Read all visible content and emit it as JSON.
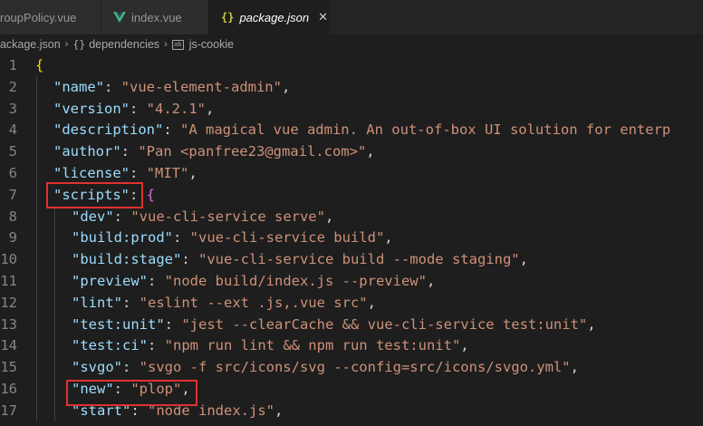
{
  "tabs": [
    {
      "label": "roupPolicy.vue",
      "icon": "vue-icon",
      "active": false
    },
    {
      "label": "index.vue",
      "icon": "vue-icon",
      "active": false
    },
    {
      "label": "package.json",
      "icon": "json-icon",
      "active": true,
      "close": "✕"
    }
  ],
  "breadcrumb": {
    "file": "package.json",
    "node": "dependencies",
    "leaf": "js-cookie",
    "node_icon": "{}",
    "sep": "›"
  },
  "lines": [
    {
      "n": "1",
      "parts": [
        [
          "b1",
          "{"
        ]
      ]
    },
    {
      "n": "2",
      "parts": [
        [
          "k",
          "\"name\""
        ],
        [
          "p",
          ": "
        ],
        [
          "s",
          "\"vue-element-admin\""
        ],
        [
          "p",
          ","
        ]
      ]
    },
    {
      "n": "3",
      "parts": [
        [
          "k",
          "\"version\""
        ],
        [
          "p",
          ": "
        ],
        [
          "s",
          "\"4.2.1\""
        ],
        [
          "p",
          ","
        ]
      ]
    },
    {
      "n": "4",
      "parts": [
        [
          "k",
          "\"description\""
        ],
        [
          "p",
          ": "
        ],
        [
          "s",
          "\"A magical vue admin. An out-of-box UI solution for enterp"
        ]
      ]
    },
    {
      "n": "5",
      "parts": [
        [
          "k",
          "\"author\""
        ],
        [
          "p",
          ": "
        ],
        [
          "s",
          "\"Pan <panfree23@gmail.com>\""
        ],
        [
          "p",
          ","
        ]
      ]
    },
    {
      "n": "6",
      "parts": [
        [
          "k",
          "\"license\""
        ],
        [
          "p",
          ": "
        ],
        [
          "s",
          "\"MIT\""
        ],
        [
          "p",
          ","
        ]
      ]
    },
    {
      "n": "7",
      "parts": [
        [
          "k",
          "\"scripts\""
        ],
        [
          "p",
          ": "
        ],
        [
          "b2",
          "{"
        ]
      ]
    },
    {
      "n": "8",
      "parts": [
        [
          "k",
          "\"dev\""
        ],
        [
          "p",
          ": "
        ],
        [
          "s",
          "\"vue-cli-service serve\""
        ],
        [
          "p",
          ","
        ]
      ]
    },
    {
      "n": "9",
      "parts": [
        [
          "k",
          "\"build:prod\""
        ],
        [
          "p",
          ": "
        ],
        [
          "s",
          "\"vue-cli-service build\""
        ],
        [
          "p",
          ","
        ]
      ]
    },
    {
      "n": "10",
      "parts": [
        [
          "k",
          "\"build:stage\""
        ],
        [
          "p",
          ": "
        ],
        [
          "s",
          "\"vue-cli-service build --mode staging\""
        ],
        [
          "p",
          ","
        ]
      ]
    },
    {
      "n": "11",
      "parts": [
        [
          "k",
          "\"preview\""
        ],
        [
          "p",
          ": "
        ],
        [
          "s",
          "\"node build/index.js --preview\""
        ],
        [
          "p",
          ","
        ]
      ]
    },
    {
      "n": "12",
      "parts": [
        [
          "k",
          "\"lint\""
        ],
        [
          "p",
          ": "
        ],
        [
          "s",
          "\"eslint --ext .js,.vue src\""
        ],
        [
          "p",
          ","
        ]
      ]
    },
    {
      "n": "13",
      "parts": [
        [
          "k",
          "\"test:unit\""
        ],
        [
          "p",
          ": "
        ],
        [
          "s",
          "\"jest --clearCache && vue-cli-service test:unit\""
        ],
        [
          "p",
          ","
        ]
      ]
    },
    {
      "n": "14",
      "parts": [
        [
          "k",
          "\"test:ci\""
        ],
        [
          "p",
          ": "
        ],
        [
          "s",
          "\"npm run lint && npm run test:unit\""
        ],
        [
          "p",
          ","
        ]
      ]
    },
    {
      "n": "15",
      "parts": [
        [
          "k",
          "\"svgo\""
        ],
        [
          "p",
          ": "
        ],
        [
          "s",
          "\"svgo -f src/icons/svg --config=src/icons/svgo.yml\""
        ],
        [
          "p",
          ","
        ]
      ]
    },
    {
      "n": "16",
      "parts": [
        [
          "k",
          "\"new\""
        ],
        [
          "p",
          ": "
        ],
        [
          "s",
          "\"plop\""
        ],
        [
          "p",
          ","
        ]
      ]
    },
    {
      "n": "17",
      "parts": [
        [
          "k",
          "\"start\""
        ],
        [
          "p",
          ": "
        ],
        [
          "s",
          "\"node index.js\""
        ],
        [
          "p",
          ","
        ]
      ]
    }
  ],
  "highlights": [
    {
      "name": "scripts-key-highlight",
      "line": "7"
    },
    {
      "name": "new-plop-highlight",
      "line": "16"
    }
  ],
  "colors": {
    "annotation": "#e03131",
    "vue_green": "#41b883",
    "json_yellow": "#cbcb41"
  }
}
